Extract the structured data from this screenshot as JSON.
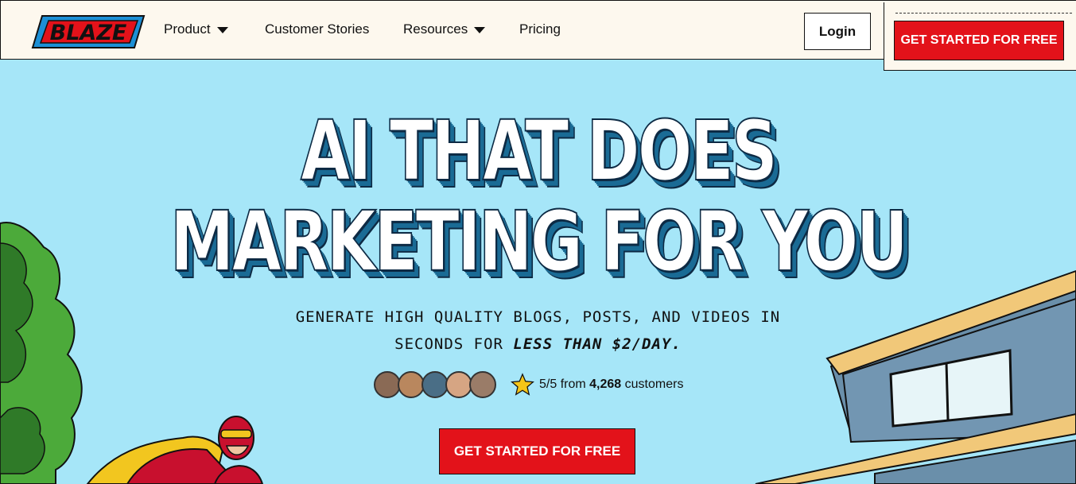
{
  "nav": {
    "logo_text": "BLAZE",
    "items": [
      {
        "label": "Product",
        "has_dropdown": true
      },
      {
        "label": "Customer Stories",
        "has_dropdown": false
      },
      {
        "label": "Resources",
        "has_dropdown": true
      },
      {
        "label": "Pricing",
        "has_dropdown": false
      }
    ],
    "login_label": "Login",
    "cta_label": "GET STARTED FOR FREE"
  },
  "hero": {
    "headline_line1": "AI THAT DOES",
    "headline_line2": "MARKETING FOR YOU",
    "subheadline_line1": "GENERATE HIGH QUALITY BLOGS, POSTS, AND VIDEOS IN",
    "subheadline_line2_prefix": "SECONDS FOR ",
    "subheadline_line2_emphasis": "LESS THAN $2/DAY.",
    "rating_score": "5/5",
    "rating_from": "from",
    "rating_count": "4,268",
    "rating_suffix": "customers",
    "cta_label": "GET STARTED FOR FREE"
  },
  "colors": {
    "accent_red": "#e3121a",
    "sky_blue": "#a6e6f8",
    "nav_bg": "#fdf8ee",
    "headline_shadow": "#1a6b95"
  }
}
